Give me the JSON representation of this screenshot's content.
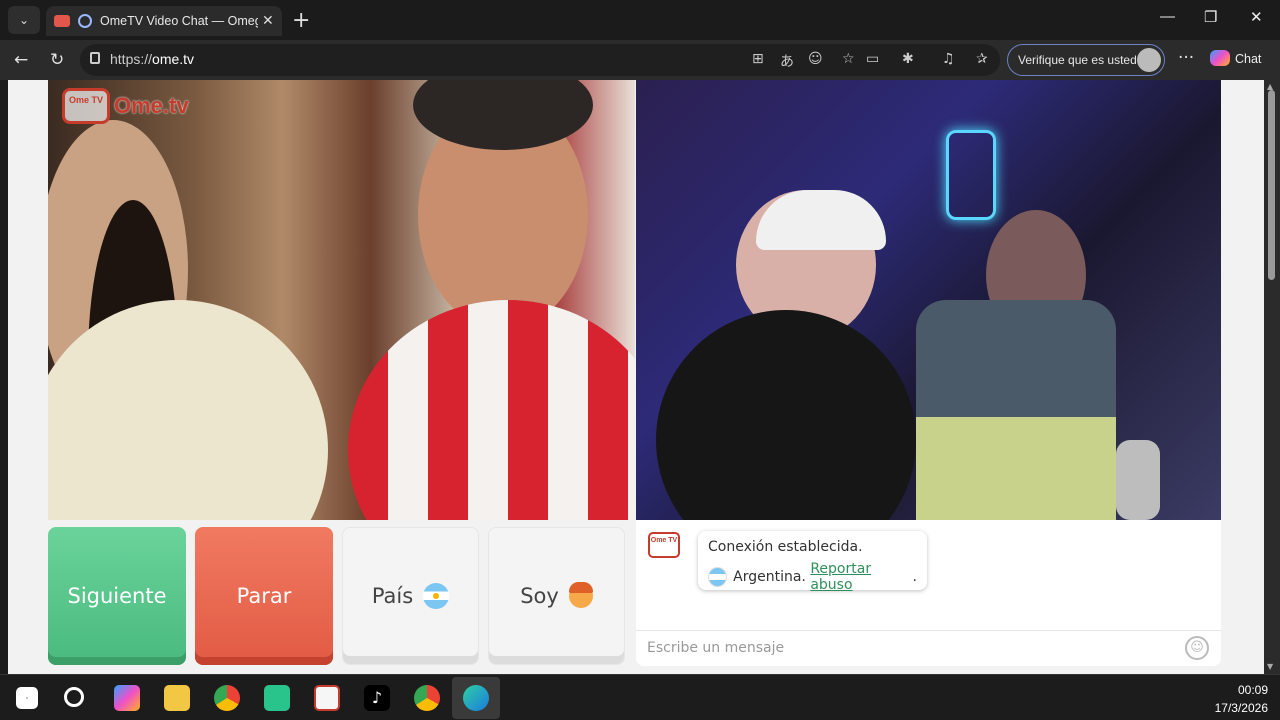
{
  "browser": {
    "tab_title": "OmeTV Video Chat — Omegle",
    "url_prefix": "https://",
    "url_host": "ome.tv",
    "verify_label": "Verifique que es usted",
    "chat_label": "Chat"
  },
  "site": {
    "logo_tv": "Ome TV",
    "logo_word": "Ome.tv"
  },
  "controls": {
    "next_label": "Siguiente",
    "stop_label": "Parar",
    "country_label": "País",
    "gender_label": "Soy"
  },
  "chat": {
    "bot_logo": "Ome TV",
    "message_1": "Conexión establecida.",
    "country": "Argentina.",
    "report_link": "Reportar abuso",
    "report_suffix": ".",
    "input_placeholder": "Escribe un mensaje"
  },
  "taskbar": {
    "time": "00:09",
    "date": "17/3/2026"
  },
  "colors": {
    "next": "#4aba7e",
    "stop": "#e25a44",
    "link": "#2f8f5a",
    "brand": "#c53c2d"
  }
}
